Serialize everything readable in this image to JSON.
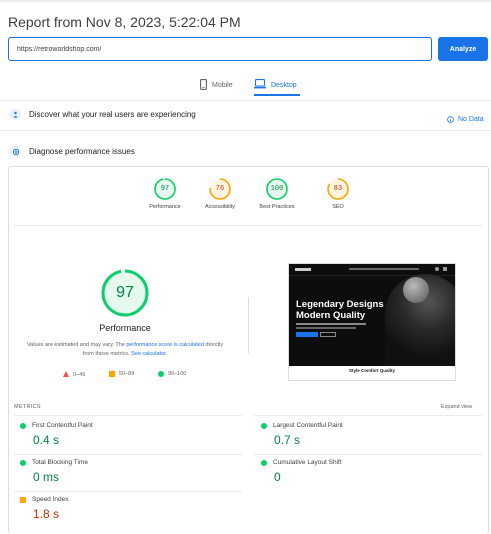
{
  "report": {
    "title": "Report from Nov 8, 2023, 5:22:04 PM"
  },
  "search": {
    "value": "https://retroworldshop.com/",
    "analyze_label": "Analyze"
  },
  "tabs": [
    {
      "label": "Mobile"
    },
    {
      "label": "Desktop",
      "active": true
    }
  ],
  "real_users": {
    "text": "Discover what your real users are experiencing",
    "no_data": "No Data"
  },
  "diagnose": {
    "text": "Diagnose performance issues"
  },
  "categories": [
    {
      "score": "97",
      "label": "Performance",
      "color": "#0cce6b",
      "level": 0.97
    },
    {
      "score": "76",
      "label": "Accessibility",
      "color": "#ffa400",
      "level": 0.76
    },
    {
      "score": "100",
      "label": "Best Practices",
      "color": "#0cce6b",
      "level": 1.0
    },
    {
      "score": "83",
      "label": "SEO",
      "color": "#ffa400",
      "level": 0.83
    }
  ],
  "performance": {
    "score": "97",
    "level": 0.97,
    "label": "Performance",
    "note_prefix": "Values are estimated and may vary. The ",
    "note_link1": "performance score is calculated",
    "note_mid": " directly from these metrics. ",
    "note_link2": "See calculator."
  },
  "legend": [
    {
      "range": "0–49",
      "color": "#ff4e42"
    },
    {
      "range": "50–89",
      "color": "#ffa400"
    },
    {
      "range": "90–100",
      "color": "#0cce6b"
    }
  ],
  "screenshot": {
    "headline1": "Legendary Designs",
    "headline2": "Modern Quality",
    "caption": "Style Comfort Quality"
  },
  "metrics": {
    "header": "METRICS",
    "expand": "Expand view",
    "items": [
      {
        "label": "First Contentful Paint",
        "value": "0.4 s",
        "status": "good"
      },
      {
        "label": "Largest Contentful Paint",
        "value": "0.7 s",
        "status": "good"
      },
      {
        "label": "Total Blocking Time",
        "value": "0 ms",
        "status": "good"
      },
      {
        "label": "Cumulative Layout Shift",
        "value": "0",
        "status": "good"
      },
      {
        "label": "Speed Index",
        "value": "1.8 s",
        "status": "average"
      }
    ]
  },
  "colors": {
    "accent": "#1a73e8",
    "good": "#0cce6b",
    "average": "#ffa400",
    "poor": "#ff4e42"
  }
}
